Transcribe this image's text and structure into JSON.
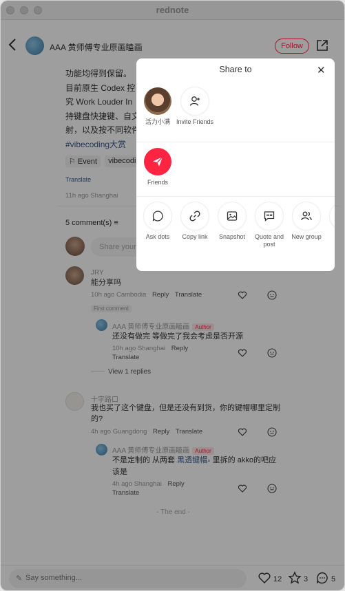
{
  "window": {
    "title": "rednote"
  },
  "header": {
    "author": "AAA 黄师傅专业原画瞌画",
    "follow_label": "Follow"
  },
  "post": {
    "lines": [
      "功能均得到保留。",
      "目前原生 Codex 控",
      "究 Work Louder In",
      "持键盘快捷键、自文",
      "射，以及按不同软件"
    ],
    "hashtag": "#vibecoding大赏",
    "tags": [
      "Event",
      "vibecodin"
    ],
    "translate": "Translate",
    "meta": "11h ago Shanghai"
  },
  "comments_section": {
    "count_label": "5 comment(s)",
    "input_placeholder": "Share your"
  },
  "comments": [
    {
      "name": "JRY",
      "text": "能分享吗",
      "time_loc": "10h ago Cambodia",
      "reply": "Reply",
      "translate": "Translate",
      "badge": "First comment",
      "reply_item": {
        "name": "AAA 黄师傅专业原画瞌画",
        "badge": "Author",
        "text": "还没有做完 等做完了我会考虑是否开源",
        "time_loc": "10h ago Shanghai",
        "reply": "Reply",
        "translate": "Translate"
      },
      "view_replies": "View 1 replies"
    },
    {
      "name": "十字路口",
      "text_line1": "我也买了这个键盘，但是还没有到货，你的键帽哪里定制",
      "text_line2": "的?",
      "time_loc": "4h ago Guangdong",
      "reply": "Reply",
      "translate": "Translate",
      "reply_item": {
        "name": "AAA 黄师傅专业原画瞌画",
        "badge": "Author",
        "text_pre": "不是定制的 从两套 ",
        "text_link": "黑透键帽",
        "text_post": " 里拆的 akko的吧应",
        "text_line2": "该是",
        "time_loc": "4h ago Shanghai",
        "reply": "Reply",
        "translate": "Translate"
      }
    }
  ],
  "the_end": "- The end -",
  "bottom_bar": {
    "placeholder": "Say something...",
    "likes": "12",
    "stars": "3",
    "comments": "5"
  },
  "share_modal": {
    "title": "Share to",
    "contacts": [
      {
        "label": "活力小满",
        "icon": "friend-avatar"
      },
      {
        "label": "Invite Friends",
        "icon": "add-person-icon"
      }
    ],
    "friends_label": "Friends",
    "actions": [
      {
        "label": "Ask dots",
        "icon": "chat-bubble-icon"
      },
      {
        "label": "Copy link",
        "icon": "link-icon"
      },
      {
        "label": "Snapshot",
        "icon": "image-icon"
      },
      {
        "label": "Quote and post",
        "icon": "quote-icon"
      },
      {
        "label": "New group",
        "icon": "group-icon"
      }
    ]
  },
  "colors": {
    "accent": "#ff2442",
    "link": "#3a5a8f"
  }
}
